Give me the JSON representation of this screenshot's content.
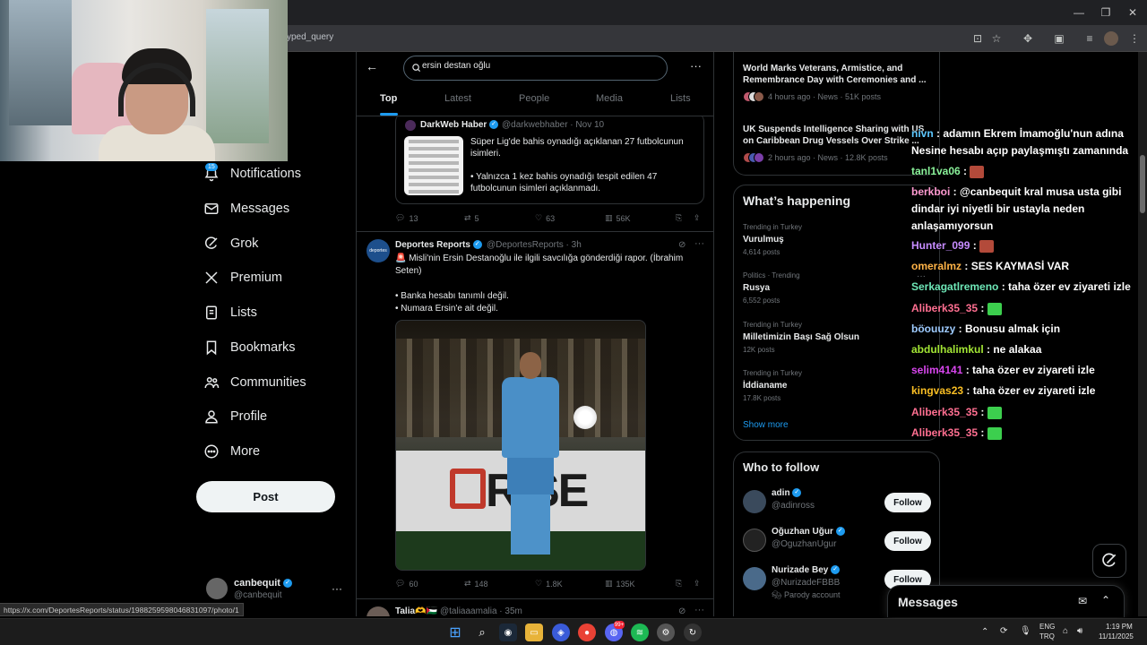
{
  "browser": {
    "url_fragment": "yped_query",
    "window_controls": [
      "—",
      "❐",
      "✕"
    ]
  },
  "nav": {
    "notifications_badge": "15",
    "items": [
      {
        "label": "Notifications",
        "icon": "bell-icon"
      },
      {
        "label": "Messages",
        "icon": "envelope-icon"
      },
      {
        "label": "Grok",
        "icon": "grok-icon"
      },
      {
        "label": "Premium",
        "icon": "x-logo-icon"
      },
      {
        "label": "Lists",
        "icon": "list-icon"
      },
      {
        "label": "Bookmarks",
        "icon": "bookmark-icon"
      },
      {
        "label": "Communities",
        "icon": "people-icon"
      },
      {
        "label": "Profile",
        "icon": "person-icon"
      },
      {
        "label": "More",
        "icon": "more-circle-icon"
      }
    ],
    "post_label": "Post"
  },
  "account": {
    "name": "canbequit",
    "handle": "@canbequit",
    "more": "···"
  },
  "status_url": "https://x.com/DeportesReports/status/1988259598046831097/photo/1",
  "search": {
    "query": "ersin destan oğlu",
    "more": "···",
    "tabs": [
      "Top",
      "Latest",
      "People",
      "Media",
      "Lists"
    ],
    "active_tab": 0
  },
  "quoted_tweet": {
    "name": "DarkWeb Haber",
    "meta": "@darkwebhaber · Nov 10",
    "text1": "Süper Lig'de bahis oynadığı açıklanan 27 futbolcunun isimleri.",
    "text2": "• Yalnızca 1 kez bahis oynadığı tespit edilen 47 futbolcunun isimleri açıklanmadı."
  },
  "tweet1_actions": {
    "replies": "13",
    "reposts": "5",
    "likes": "63",
    "views": "56K"
  },
  "tweet2": {
    "avatar_text": "deportes",
    "name": "Deportes Reports",
    "meta": "@DeportesReports · 3h",
    "more": "···",
    "lines": [
      "🚨 Misli'nin Ersin Destanoğlu ile ilgili savcılığa gönderdiği rapor. (İbrahim Seten)",
      "",
      "• Banka hesabı tanımlı değil.",
      "• Numara Ersin'e ait değil."
    ],
    "photo_banner": "RISE",
    "actions": {
      "replies": "60",
      "reposts": "148",
      "likes": "1.8K",
      "views": "135K"
    }
  },
  "tweet3": {
    "name": "Talia🫶🇵🇸",
    "meta": "@taliaaamalia · 35m",
    "more": "···"
  },
  "news": [
    {
      "title": "World Marks Veterans, Armistice, and Remembrance Day with Ceremonies and ...",
      "meta": "4 hours ago · News · 51K posts"
    },
    {
      "title": "UK Suspends Intelligence Sharing with US on Caribbean Drug Vessels Over Strike ...",
      "meta": "2 hours ago · News · 12.8K posts"
    }
  ],
  "whats_happening": {
    "title": "What’s happening",
    "trends": [
      {
        "category": "Trending in Turkey",
        "name": "Vurulmuş",
        "posts": "4,614 posts"
      },
      {
        "category": "Politics · Trending",
        "name": "Rusya",
        "posts": "6,552 posts"
      },
      {
        "category": "Trending in Turkey",
        "name": "Milletimizin Başı Sağ Olsun",
        "posts": "12K posts"
      },
      {
        "category": "Trending in Turkey",
        "name": "İddianame",
        "posts": "17.8K posts"
      }
    ],
    "more_icon": "···",
    "show_more": "Show more"
  },
  "who_to_follow": {
    "title": "Who to follow",
    "button": "Follow",
    "accounts": [
      {
        "name": "adin",
        "handle": "@adinross",
        "sub": ""
      },
      {
        "name": "Oğuzhan Uğur",
        "handle": "@OguzhanUgur",
        "sub": ""
      },
      {
        "name": "Nurizade Bey",
        "handle": "@NurizadeFBBB",
        "sub": "Parody account"
      }
    ]
  },
  "chat": [
    {
      "user": "nivn",
      "color": "#5dc8ff",
      "msg": " : adamın Ekrem İmamoğlu'nun adına Nesine hesabı açıp paylaşmıştı zamanında"
    },
    {
      "user": "tanl1va06",
      "color": "#8af29a",
      "msg": " : ",
      "emote": "#b34a3a"
    },
    {
      "user": "berkboi",
      "color": "#ff9ad1",
      "msg": " : @canbequit kral musa usta gibi dindar iyi niyetli bir ustayla neden anlaşamıyorsun"
    },
    {
      "user": "Hunter_099",
      "color": "#c78cff",
      "msg": " : ",
      "emote": "#b34a3a"
    },
    {
      "user": "omeralmz",
      "color": "#ffb347",
      "msg": " : SES KAYMASİ VAR"
    },
    {
      "user": "Serkagatlremeno",
      "color": "#6ee7b7",
      "msg": " : taha özer ev ziyareti izle"
    },
    {
      "user": "Aliberk35_35",
      "color": "#ff6f91",
      "msg": " : ",
      "emote": "#3ccf4e"
    },
    {
      "user": "böouuzy",
      "color": "#9ecbff",
      "msg": " : Bonusu almak için"
    },
    {
      "user": "abdulhalimkul",
      "color": "#a3e635",
      "msg": " : ne alakaa"
    },
    {
      "user": "selim4141",
      "color": "#d946ef",
      "msg": " : taha özer ev ziyareti izle"
    },
    {
      "user": "kingvas23",
      "color": "#fbbf24",
      "msg": " : taha özer ev ziyareti izle"
    },
    {
      "user": "Aliberk35_35",
      "color": "#ff6f91",
      "msg": " : ",
      "emote": "#3ccf4e"
    },
    {
      "user": "Aliberk35_35",
      "color": "#ff6f91",
      "msg": " : ",
      "emote": "#3ccf4e"
    }
  ],
  "messages_drawer": {
    "title": "Messages"
  },
  "taskbar": {
    "lang": "ENG",
    "layout": "TRQ",
    "time": "1:19 PM",
    "date": "11/11/2025",
    "discord_badge": "99+"
  }
}
